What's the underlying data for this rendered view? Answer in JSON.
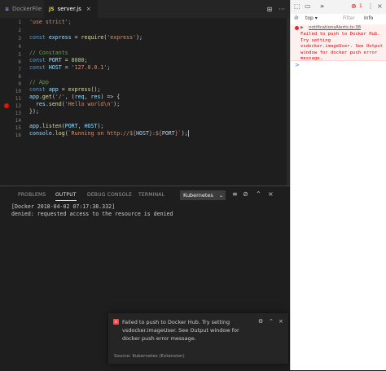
{
  "tabs": [
    {
      "label": "DockerFile",
      "icon": "≡",
      "icon_name": "dockerfile-icon"
    },
    {
      "label": "server.js",
      "icon": "JS",
      "icon_name": "js-file-icon",
      "close": "×"
    }
  ],
  "editor_actions": {
    "split": "⊞",
    "more": "···"
  },
  "code_lines": [
    {
      "n": "1"
    },
    {
      "n": "2"
    },
    {
      "n": "3"
    },
    {
      "n": "4"
    },
    {
      "n": "5"
    },
    {
      "n": "6"
    },
    {
      "n": "7"
    },
    {
      "n": "8"
    },
    {
      "n": "9"
    },
    {
      "n": "10"
    },
    {
      "n": "11"
    },
    {
      "n": "12"
    },
    {
      "n": "13"
    },
    {
      "n": "14"
    },
    {
      "n": "15"
    },
    {
      "n": "16"
    }
  ],
  "code": {
    "l1": "'use strict';",
    "l3a": "const ",
    "l3b": "express",
    "l3c": " = ",
    "l3d": "require",
    "l3e": "(",
    "l3f": "'express'",
    "l3g": ");",
    "l5": "// Constants",
    "l6a": "const ",
    "l6b": "PORT",
    "l6c": " = ",
    "l6d": "8080",
    "l6e": ";",
    "l7a": "const ",
    "l7b": "HOST",
    "l7c": " = ",
    "l7d": "'127.0.0.1'",
    "l7e": ";",
    "l9": "// App",
    "l10a": "const ",
    "l10b": "app",
    "l10c": " = ",
    "l10d": "express",
    "l10e": "();",
    "l11a": "app",
    "l11b": ".",
    "l11c": "get",
    "l11d": "(",
    "l11e": "'/'",
    "l11f": ", (",
    "l11g": "req",
    "l11h": ", ",
    "l11i": "res",
    "l11j": ") => {",
    "l12a": "  res",
    "l12b": ".",
    "l12c": "send",
    "l12d": "(",
    "l12e": "'Hello world\\n'",
    "l12f": ");",
    "l13": "});",
    "l15a": "app",
    "l15b": ".",
    "l15c": "listen",
    "l15d": "(",
    "l15e": "PORT",
    "l15f": ", ",
    "l15g": "HOST",
    "l15h": ");",
    "l16a": "console",
    "l16b": ".",
    "l16c": "log",
    "l16d": "(",
    "l16e": "`Running on http://${",
    "l16f": "HOST",
    "l16g": "}:${",
    "l16h": "PORT",
    "l16i": "}`",
    "l16j": ");"
  },
  "panel": {
    "tabs": [
      "PROBLEMS",
      "OUTPUT",
      "DEBUG CONSOLE",
      "TERMINAL"
    ],
    "channel": "Kubernetes",
    "chevron": "⌄",
    "output": [
      "[Docker 2018-04-02 07:17:38.332]",
      "denied: requested access to the resource is denied"
    ]
  },
  "notification": {
    "message": "Failed to push to Docker Hub. Try setting vsdocker.imageUser. See Output window for docker push error message.",
    "source": "Source: Kubernetes (Extension)",
    "gear": "⚙",
    "collapse": "⌃",
    "close": "×"
  },
  "devtools": {
    "context": "top",
    "filter_placeholder": "Filter",
    "levels": "Info",
    "error_count": "1",
    "location": "notificationsAlerts.ts:38",
    "error_text": "Failed to push to Docker Hub. Try setting vsdocker.imageUser. See Output window for docker push error message.",
    "prompt": ">"
  },
  "colors": {
    "editor_bg": "#1e1e1e",
    "tab_bar_bg": "#252526",
    "keyword": "#569cd6",
    "string": "#ce9178",
    "comment": "#6a9955",
    "error": "#f14c4c"
  }
}
